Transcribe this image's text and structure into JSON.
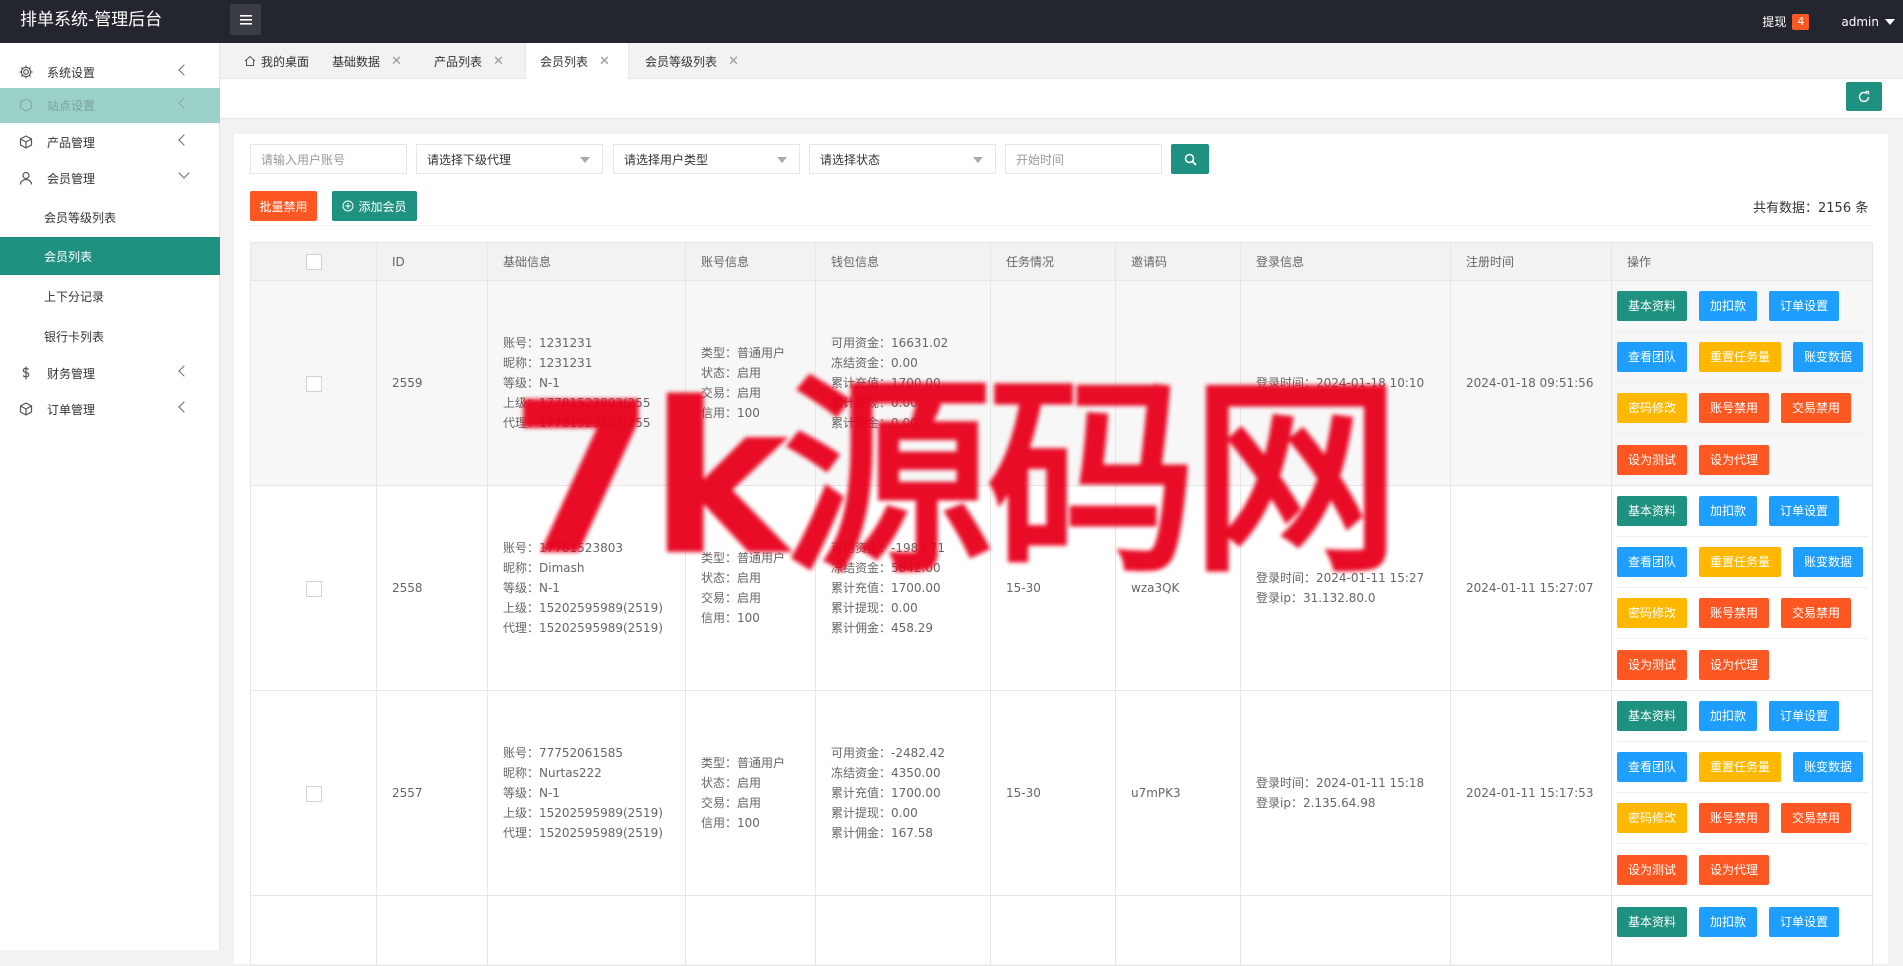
{
  "app": {
    "title": "排单系统-管理后台"
  },
  "header": {
    "withdraw_label": "提现",
    "withdraw_count": "4",
    "user": "admin"
  },
  "sidebar": {
    "items": [
      {
        "label": "系统设置",
        "icon": "gear-icon"
      },
      {
        "label": "站点设置",
        "icon": "globe-icon"
      },
      {
        "label": "产品管理",
        "icon": "cube-icon"
      },
      {
        "label": "会员管理",
        "icon": "user-icon"
      },
      {
        "label": "财务管理",
        "icon": "dollar-icon"
      },
      {
        "label": "订单管理",
        "icon": "cube-icon"
      }
    ],
    "sub_items": [
      "会员等级列表",
      "会员列表",
      "上下分记录",
      "银行卡列表"
    ]
  },
  "tabs": [
    {
      "label": "我的桌面"
    },
    {
      "label": "基础数据"
    },
    {
      "label": "产品列表"
    },
    {
      "label": "会员列表"
    },
    {
      "label": "会员等级列表"
    }
  ],
  "filters": {
    "account_placeholder": "请输入用户账号",
    "agent_select": "请选择下级代理",
    "type_select": "请选择用户类型",
    "status_select": "请选择状态",
    "start_time_placeholder": "开始时间"
  },
  "actions": {
    "batch_ban": "批量禁用",
    "add_member": "添加会员",
    "total": "共有数据：2156 条"
  },
  "table": {
    "headers": [
      "ID",
      "基础信息",
      "账号信息",
      "钱包信息",
      "任务情况",
      "邀请码",
      "登录信息",
      "注册时间",
      "操作"
    ],
    "op_buttons": [
      [
        "基本资料",
        "加扣款",
        "订单设置"
      ],
      [
        "查看团队",
        "重置任务量",
        "账变数据"
      ],
      [
        "密码修改",
        "账号禁用",
        "交易禁用"
      ],
      [
        "设为测试",
        "设为代理"
      ]
    ],
    "rows": [
      {
        "id": "2559",
        "basic": [
          "账号：1231231",
          "昵称：1231231",
          "等级：N-1",
          "上级：17781523803(255",
          "代理：17781523803(255"
        ],
        "account": [
          "类型：普通用户",
          "状态：启用",
          "交易：启用",
          "信用：100"
        ],
        "wallet": [
          "可用资金：16631.02",
          "冻结资金：0.00",
          "累计充值：1700.00",
          "累计提现：0.00",
          "累计佣金：0.00"
        ],
        "task": "",
        "invite": "",
        "login": [
          "登录时间：2024-01-18 10:10",
          ""
        ],
        "reg_time": "2024-01-18 09:51:56"
      },
      {
        "id": "2558",
        "basic": [
          "账号：17781523803",
          "昵称：Dimash",
          "等级：N-1",
          "上级：15202595989(2519)",
          "代理：15202595989(2519)"
        ],
        "account": [
          "类型：普通用户",
          "状态：启用",
          "交易：启用",
          "信用：100"
        ],
        "wallet": [
          "可用资金：-1983.71",
          "冻结资金：5842.00",
          "累计充值：1700.00",
          "累计提现：0.00",
          "累计佣金：458.29"
        ],
        "task": "15-30",
        "invite": "wza3QK",
        "login": [
          "登录时间：2024-01-11 15:27",
          "登录ip：31.132.80.0"
        ],
        "reg_time": "2024-01-11 15:27:07"
      },
      {
        "id": "2557",
        "basic": [
          "账号：77752061585",
          "昵称：Nurtas222",
          "等级：N-1",
          "上级：15202595989(2519)",
          "代理：15202595989(2519)"
        ],
        "account": [
          "类型：普通用户",
          "状态：启用",
          "交易：启用",
          "信用：100"
        ],
        "wallet": [
          "可用资金：-2482.42",
          "冻结资金：4350.00",
          "累计充值：1700.00",
          "累计提现：0.00",
          "累计佣金：167.58"
        ],
        "task": "15-30",
        "invite": "u7mPK3",
        "login": [
          "登录时间：2024-01-11 15:18",
          "登录ip：2.135.64.98"
        ],
        "reg_time": "2024-01-11 15:17:53"
      }
    ]
  },
  "watermark": "7k源码网",
  "colors": {
    "primary": "#1f9180",
    "blue": "#1e9fff",
    "orange": "#ffb800",
    "red": "#ff5722",
    "header": "#23262e"
  }
}
